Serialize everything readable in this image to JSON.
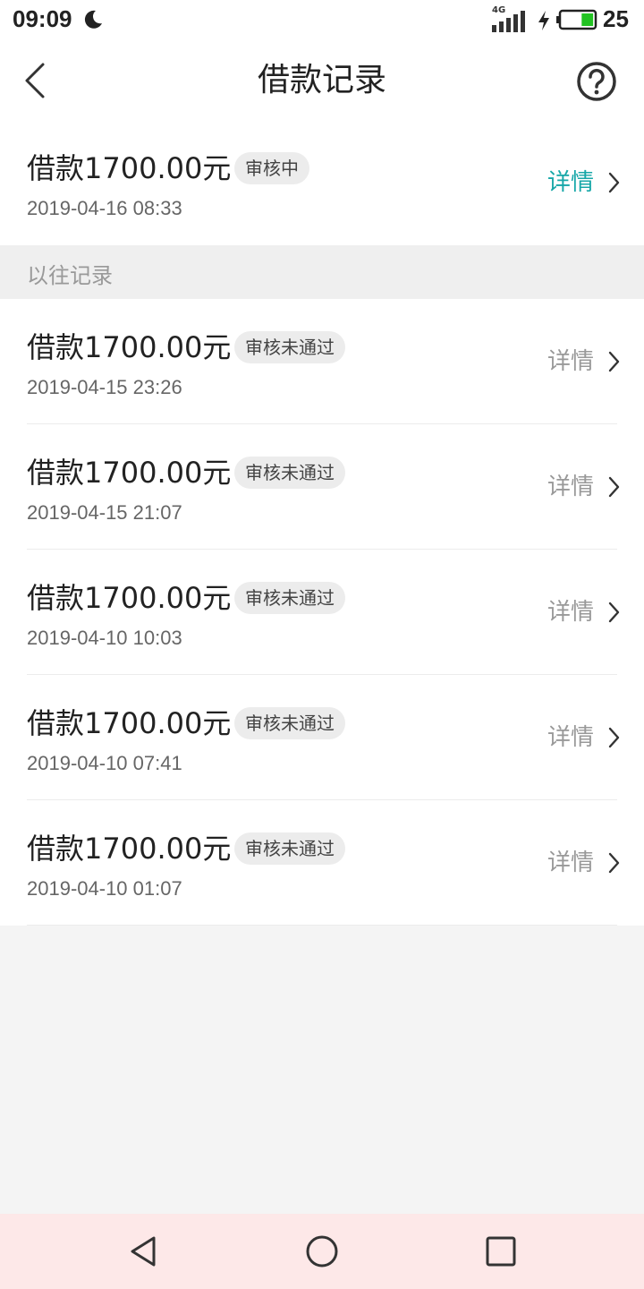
{
  "status_bar": {
    "time": "09:09",
    "network": "4G",
    "battery": "25",
    "battery_fraction": 0.25
  },
  "nav": {
    "title": "借款记录",
    "back_icon": "chevron-left-icon",
    "help_icon": "question-circle-icon"
  },
  "current_record": {
    "amount": "借款1700.00元",
    "status": "审核中",
    "date": "2019-04-16 08:33",
    "detail": "详情"
  },
  "past_header": "以往记录",
  "past_records": [
    {
      "amount": "借款1700.00元",
      "status": "审核未通过",
      "date": "2019-04-15 23:26",
      "detail": "详情"
    },
    {
      "amount": "借款1700.00元",
      "status": "审核未通过",
      "date": "2019-04-15 21:07",
      "detail": "详情"
    },
    {
      "amount": "借款1700.00元",
      "status": "审核未通过",
      "date": "2019-04-10 10:03",
      "detail": "详情"
    },
    {
      "amount": "借款1700.00元",
      "status": "审核未通过",
      "date": "2019-04-10 07:41",
      "detail": "详情"
    },
    {
      "amount": "借款1700.00元",
      "status": "审核未通过",
      "date": "2019-04-10 01:07",
      "detail": "详情"
    }
  ],
  "colors": {
    "accent": "#17a7a8",
    "battery_fill": "#22c222",
    "system_nav_bg": "#fde8e8"
  }
}
